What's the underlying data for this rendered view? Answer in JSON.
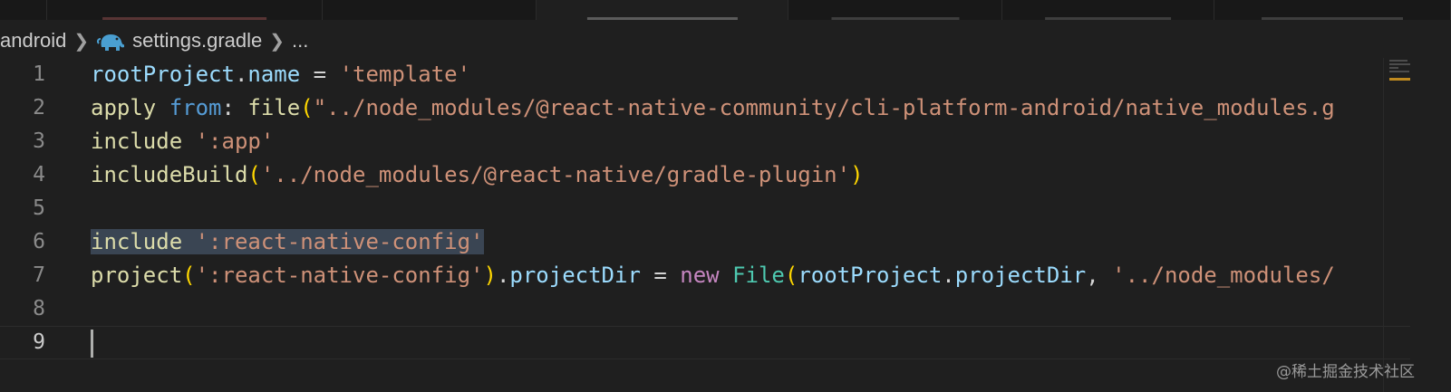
{
  "breadcrumb": {
    "folder": "android",
    "file": "settings.gradle",
    "more": "..."
  },
  "icons": {
    "breadcrumb_separator": "chevron-right-icon",
    "file_icon": "gradle-elephant-icon"
  },
  "colors": {
    "editor_bg": "#1f1f1f",
    "variable": "#9cdcfe",
    "function": "#dcdcaa",
    "keyword": "#569cd6",
    "string": "#ce9178",
    "bracket": "#ffd700",
    "new_keyword": "#c586c0",
    "class": "#4ec9b0",
    "selection": "#3a4553"
  },
  "editor": {
    "current_line": 9,
    "lines": [
      {
        "number": "1",
        "tokens": [
          {
            "t": "rootProject",
            "c": "var"
          },
          {
            "t": ".",
            "c": "pun"
          },
          {
            "t": "name",
            "c": "var"
          },
          {
            "t": " = ",
            "c": "pun"
          },
          {
            "t": "'template'",
            "c": "str"
          }
        ]
      },
      {
        "number": "2",
        "tokens": [
          {
            "t": "apply",
            "c": "fn"
          },
          {
            "t": " ",
            "c": "pun"
          },
          {
            "t": "from",
            "c": "kw"
          },
          {
            "t": ": ",
            "c": "pun"
          },
          {
            "t": "file",
            "c": "fn"
          },
          {
            "t": "(",
            "c": "br"
          },
          {
            "t": "\"../node_modules/@react-native-community/cli-platform-android/native_modules.g",
            "c": "str"
          }
        ]
      },
      {
        "number": "3",
        "tokens": [
          {
            "t": "include",
            "c": "fn"
          },
          {
            "t": " ",
            "c": "pun"
          },
          {
            "t": "':app'",
            "c": "str"
          }
        ]
      },
      {
        "number": "4",
        "tokens": [
          {
            "t": "includeBuild",
            "c": "fn"
          },
          {
            "t": "(",
            "c": "br"
          },
          {
            "t": "'../node_modules/@react-native/gradle-plugin'",
            "c": "str"
          },
          {
            "t": ")",
            "c": "br"
          }
        ]
      },
      {
        "number": "5",
        "tokens": []
      },
      {
        "number": "6",
        "selected": true,
        "tokens": [
          {
            "t": "include",
            "c": "fn"
          },
          {
            "t": " ",
            "c": "pun"
          },
          {
            "t": "':react-native-config'",
            "c": "str"
          }
        ]
      },
      {
        "number": "7",
        "tokens": [
          {
            "t": "project",
            "c": "fn"
          },
          {
            "t": "(",
            "c": "br"
          },
          {
            "t": "':react-native-config'",
            "c": "str"
          },
          {
            "t": ")",
            "c": "br"
          },
          {
            "t": ".",
            "c": "pun"
          },
          {
            "t": "projectDir",
            "c": "var"
          },
          {
            "t": " = ",
            "c": "pun"
          },
          {
            "t": "new",
            "c": "new"
          },
          {
            "t": " ",
            "c": "pun"
          },
          {
            "t": "File",
            "c": "cls"
          },
          {
            "t": "(",
            "c": "br"
          },
          {
            "t": "rootProject",
            "c": "var"
          },
          {
            "t": ".",
            "c": "pun"
          },
          {
            "t": "projectDir",
            "c": "var"
          },
          {
            "t": ", ",
            "c": "pun"
          },
          {
            "t": "'../node_modules/",
            "c": "str"
          }
        ]
      },
      {
        "number": "8",
        "tokens": []
      },
      {
        "number": "9",
        "tokens": []
      }
    ]
  },
  "watermark": "@稀土掘金技术社区"
}
